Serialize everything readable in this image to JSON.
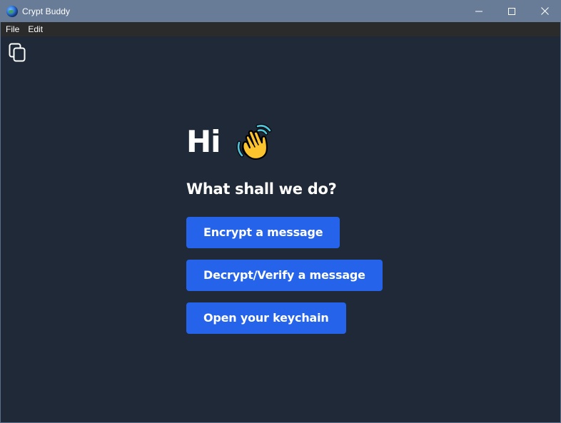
{
  "window": {
    "title": "Crypt Buddy",
    "icon": "globe-icon",
    "controls": {
      "minimize": "minimize-icon",
      "maximize": "maximize-icon",
      "close": "close-icon"
    }
  },
  "menu": {
    "items": [
      {
        "label": "File"
      },
      {
        "label": "Edit"
      }
    ]
  },
  "toolbar": {
    "copy_icon": "copy-icon"
  },
  "main": {
    "greeting": "Hi",
    "greeting_icon": "waving-hand-icon",
    "subtitle": "What shall we do?",
    "actions": [
      {
        "label": "Encrypt a message"
      },
      {
        "label": "Decrypt/Verify a message"
      },
      {
        "label": "Open your keychain"
      }
    ]
  },
  "colors": {
    "background": "#1f2937",
    "titlebar": "#687c97",
    "menubar": "#2b2b2b",
    "accent": "#2563eb",
    "text": "#ffffff"
  }
}
